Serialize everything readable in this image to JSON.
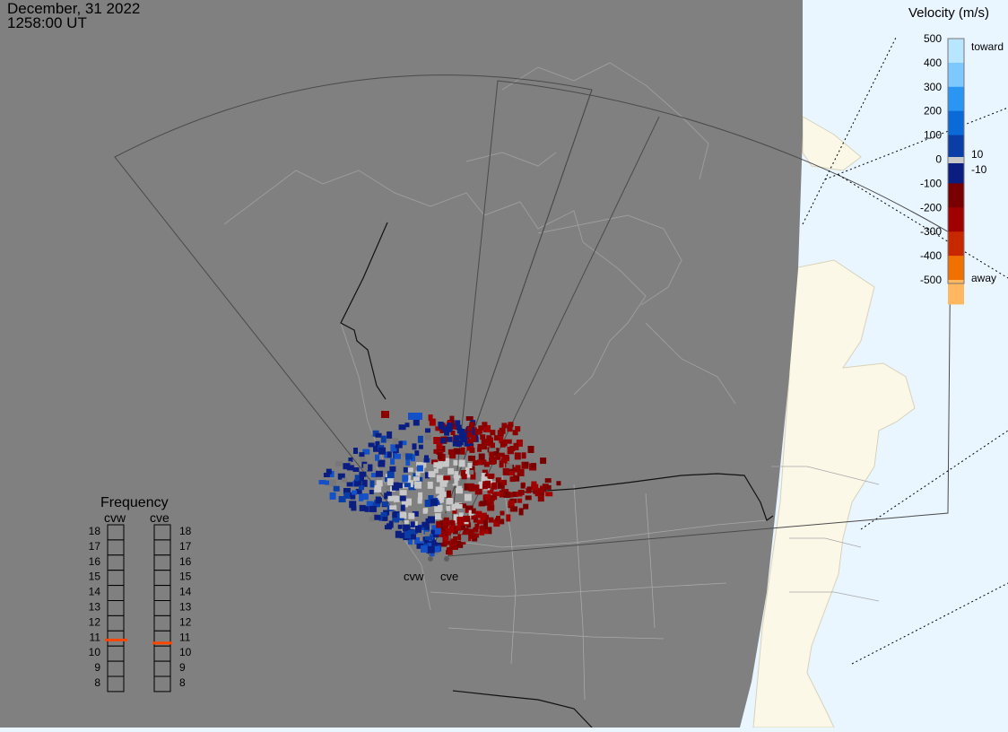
{
  "header": {
    "date": "December, 31 2022",
    "time": "1258:00 UT"
  },
  "colorbar": {
    "title": "Velocity (m/s)",
    "ticks": [
      "500",
      "400",
      "300",
      "200",
      "100",
      "0",
      "-100",
      "-200",
      "-300",
      "-400",
      "-500"
    ],
    "toward_label": "toward",
    "away_label": "away",
    "gs_upper": "10",
    "gs_lower": "-10",
    "colors": [
      "#b8e6ff",
      "#7cc8ff",
      "#2a96f4",
      "#0a6ad8",
      "#0a3ea6",
      "#0a1e82",
      "#780000",
      "#a00000",
      "#c82800",
      "#f07000",
      "#ffb860"
    ]
  },
  "frequency": {
    "title": "Frequency",
    "radars": [
      "cvw",
      "cve"
    ],
    "labels": [
      "18",
      "17",
      "16",
      "15",
      "14",
      "13",
      "12",
      "11",
      "10",
      "9",
      "8"
    ],
    "cvw_mhz": 10.9,
    "cve_mhz": 10.7
  },
  "sites": {
    "cvw_label": "cvw",
    "cve_label": "cve"
  },
  "colors": {
    "night": "#808080",
    "ocean_day": "#eaf6ff",
    "land_day": "#fbf8e8",
    "ground_scatter": "#c8c8c8",
    "toward_dark": "#0a1e82",
    "away_dark": "#8c0000",
    "freq_marker": "#ff4500"
  }
}
